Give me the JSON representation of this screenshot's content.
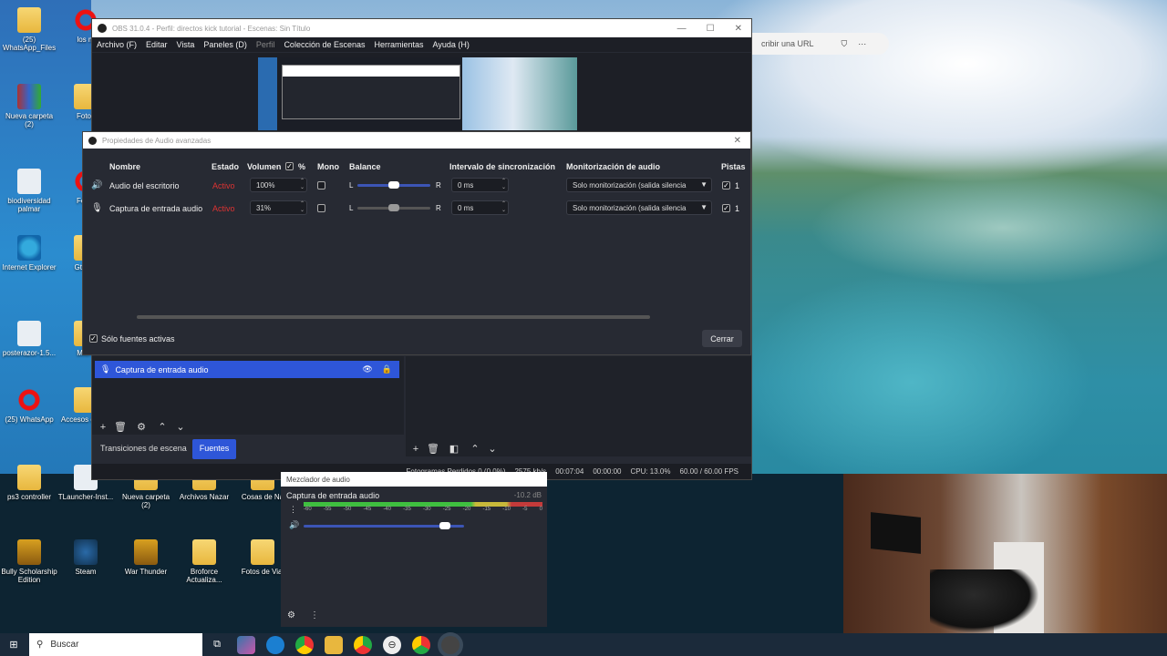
{
  "desktop": {
    "icons": [
      {
        "label": "(25) WhatsApp_Files",
        "kind": "folder"
      },
      {
        "label": "los m",
        "kind": "opera"
      },
      {
        "label": "Nueva carpeta (2)",
        "kind": "winrar"
      },
      {
        "label": "Fotos",
        "kind": "folder"
      },
      {
        "label": "biodiversidad palmar",
        "kind": "file"
      },
      {
        "label": "Fotos",
        "kind": "opera"
      },
      {
        "label": "Internet Explorer",
        "kind": "ie"
      },
      {
        "label": "Gta Sa",
        "kind": "folder"
      },
      {
        "label": "posterazor-1.5...",
        "kind": "file"
      },
      {
        "label": "Micro",
        "kind": "folder"
      },
      {
        "label": "(25) WhatsApp",
        "kind": "opera"
      },
      {
        "label": "Accesos de jue",
        "kind": "folder"
      },
      {
        "label": "ps3 controller",
        "kind": "folder"
      },
      {
        "label": "TLauncher-Inst...",
        "kind": "file"
      },
      {
        "label": "Nueva carpeta (2)",
        "kind": "folder"
      },
      {
        "label": "Archivos Nazar",
        "kind": "folder"
      },
      {
        "label": "Cosas de Na",
        "kind": "folder"
      },
      {
        "label": "Bully Scholarship Edition",
        "kind": "game"
      },
      {
        "label": "Steam",
        "kind": "steam"
      },
      {
        "label": "War Thunder",
        "kind": "game"
      },
      {
        "label": "Broforce Actualiza...",
        "kind": "folder"
      },
      {
        "label": "Fotos de Viaj",
        "kind": "folder"
      }
    ]
  },
  "browser_fragment": {
    "address_text": "cribir una URL"
  },
  "obs": {
    "title": "OBS 31.0.4 - Perfil: directos kick tutorial - Escenas: Sin Título",
    "menu": [
      "Archivo (F)",
      "Editar",
      "Vista",
      "Paneles (D)",
      "Perfil",
      "Colección de Escenas",
      "Herramientas",
      "Ayuda (H)"
    ],
    "sources": [
      {
        "label": "Captura de entrada audio"
      }
    ],
    "dock_tabs": [
      "Transiciones de escena",
      "Fuentes"
    ],
    "status": {
      "dropped": "Fotogramas Perdidos 0 (0.0%)",
      "bitrate": "2575 kb/s",
      "live": "00:07:04",
      "rec": "00:00:00",
      "cpu": "CPU: 13.0%",
      "fps": "60.00 / 60.00 FPS"
    }
  },
  "audio_props": {
    "title": "Propiedades de Audio avanzadas",
    "headers": {
      "name": "Nombre",
      "state": "Estado",
      "volume": "Volumen",
      "pct": "%",
      "mono": "Mono",
      "balance": "Balance",
      "sync": "Intervalo de sincronización",
      "monitor": "Monitorización de audio",
      "tracks": "Pistas"
    },
    "rows": [
      {
        "name": "Audio del escritorio",
        "state": "Activo",
        "volume": "100%",
        "balance_l": "L",
        "balance_r": "R",
        "sync": "0 ms",
        "monitor": "Solo monitorización (salida silencia",
        "track": "1",
        "balance_level": 0.5
      },
      {
        "name": "Captura de entrada audio",
        "state": "Activo",
        "volume": "31%",
        "balance_l": "L",
        "balance_r": "R",
        "sync": "0 ms",
        "monitor": "Solo monitorización (salida silencia",
        "track": "1",
        "balance_level": 0.5
      }
    ],
    "only_active_label": "Sólo fuentes activas",
    "close_label": "Cerrar"
  },
  "mixer": {
    "title": "Mezclador de audio",
    "channel": "Captura de entrada audio",
    "db": "-10.2 dB",
    "ticks": [
      "-60",
      "-55",
      "-50",
      "-45",
      "-40",
      "-35",
      "-30",
      "-25",
      "-20",
      "-15",
      "-10",
      "-5",
      "0"
    ],
    "volume_level": 0.88
  },
  "taskbar": {
    "search_placeholder": "Buscar"
  },
  "colors": {
    "accent": "#2e56d8",
    "active_red": "#d33",
    "meter_green": "#3fbf3f",
    "meter_yellow": "#c8b93a",
    "meter_red": "#c43a3a"
  }
}
